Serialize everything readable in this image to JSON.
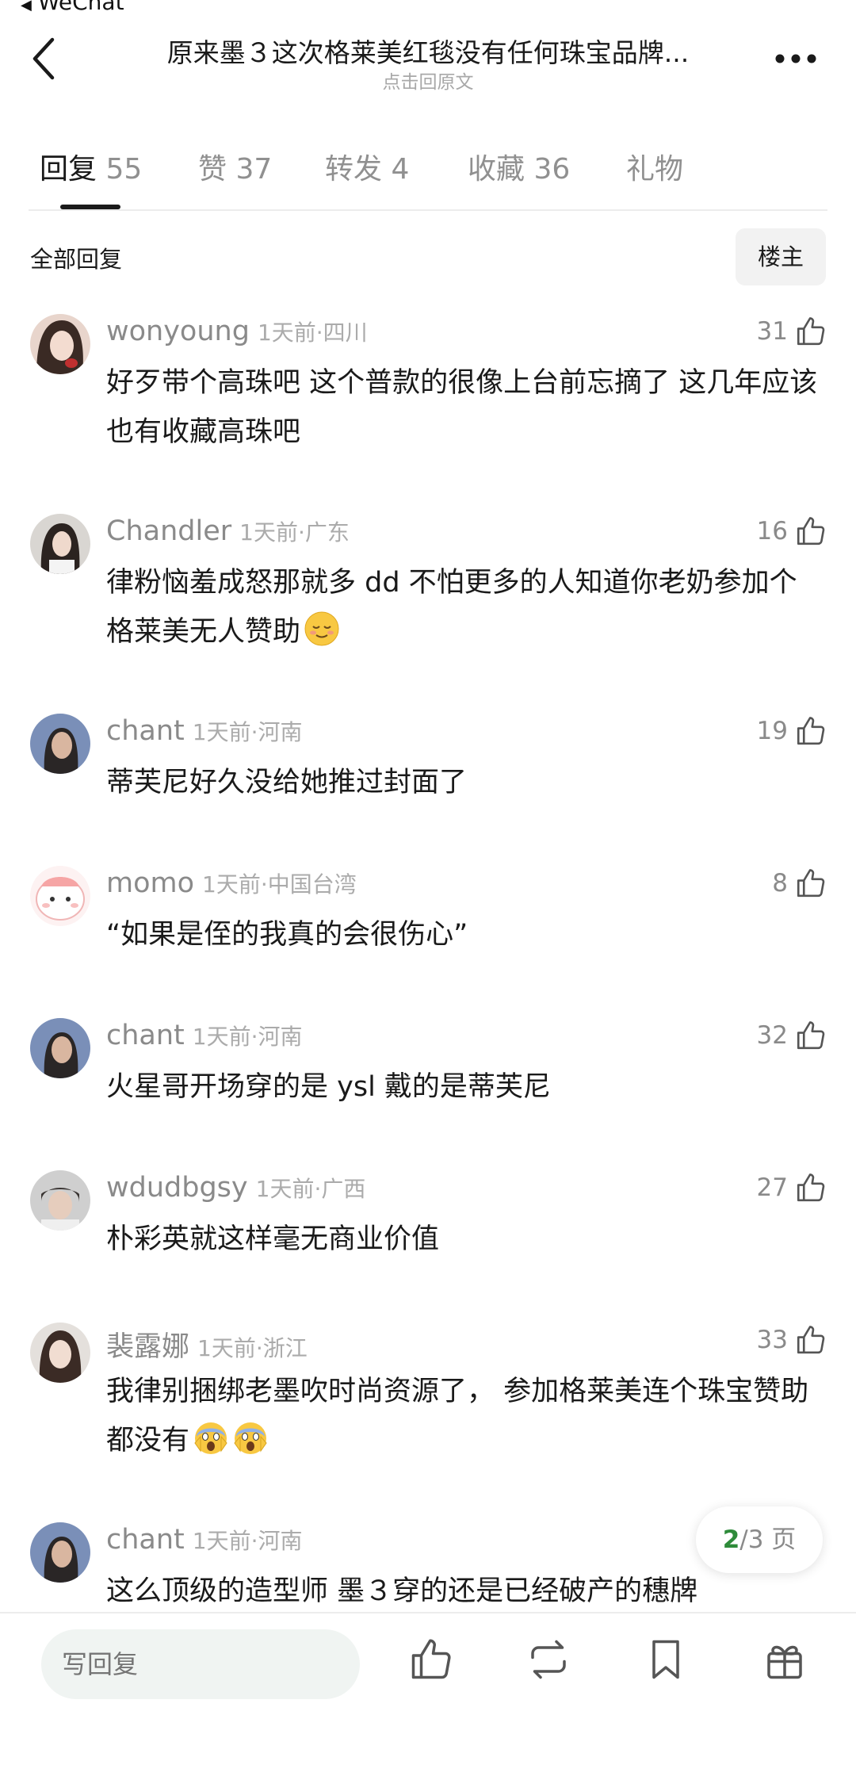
{
  "status": {
    "back_app": "WeChat"
  },
  "nav": {
    "title": "原来墨３这次格莱美红毯没有任何珠宝品牌...",
    "subtitle": "点击回原文"
  },
  "tabs": [
    {
      "label": "回复",
      "count": "55"
    },
    {
      "label": "赞",
      "count": "37"
    },
    {
      "label": "转发",
      "count": "4"
    },
    {
      "label": "收藏",
      "count": "36"
    },
    {
      "label": "礼物",
      "count": ""
    }
  ],
  "section": {
    "label": "全部回复",
    "owner_button": "楼主"
  },
  "comments": [
    {
      "name": "wonyoung",
      "meta": "1天前·四川",
      "likes": "31",
      "text": "好歹带个高珠吧 这个普款的很像上台前忘摘了 这几年应该也有收藏高珠吧",
      "emoji": ""
    },
    {
      "name": "Chandler",
      "meta": "1天前·广东",
      "likes": "16",
      "text": "律粉恼羞成怒那就多 dd 不怕更多的人知道你老奶参加个格莱美无人赞助",
      "emoji": "relieved-face"
    },
    {
      "name": "chant",
      "meta": "1天前·河南",
      "likes": "19",
      "text": "蒂芙尼好久没给她推过封面了",
      "emoji": ""
    },
    {
      "name": "momo",
      "meta": "1天前·中国台湾",
      "likes": "8",
      "text": "“如果是侄的我真的会很伤心”",
      "emoji": ""
    },
    {
      "name": "chant",
      "meta": "1天前·河南",
      "likes": "32",
      "text": "火星哥开场穿的是 ysl 戴的是蒂芙尼",
      "emoji": ""
    },
    {
      "name": "wdudbgsy",
      "meta": "1天前·广西",
      "likes": "27",
      "text": "朴彩英就这样毫无商业价值",
      "emoji": ""
    },
    {
      "name": "裴露娜",
      "meta": "1天前·浙江",
      "likes": "33",
      "text": "我律别捆绑老墨吹时尚资源了， 参加格莱美连个珠宝赞助都没有",
      "emoji": "screaming-face"
    },
    {
      "name": "chant",
      "meta": "1天前·河南",
      "likes": "",
      "text": "这么顶级的造型师 墨３穿的还是已经破产的穗牌",
      "emoji": ""
    }
  ],
  "pager": {
    "current": "2",
    "total": "/3 页"
  },
  "bottom": {
    "reply_placeholder": "写回复"
  },
  "colors": {
    "accent_green": "#2e8b3a",
    "text_primary": "#1a1a1a",
    "text_secondary": "#8a8a8a",
    "input_bg": "#f0f4f2"
  }
}
